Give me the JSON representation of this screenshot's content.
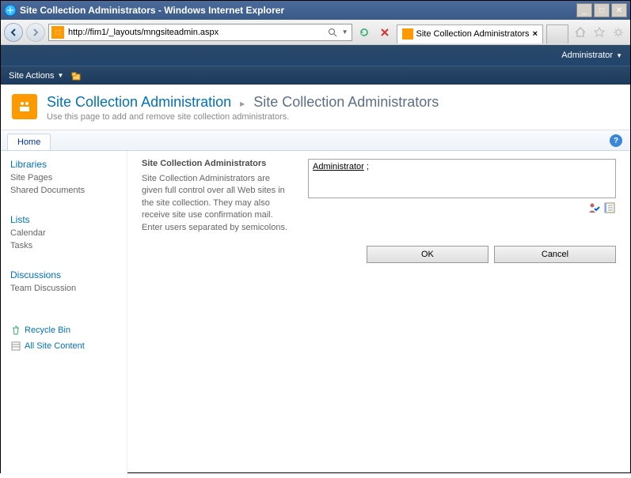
{
  "window": {
    "title": "Site Collection Administrators - Windows Internet Explorer"
  },
  "browser": {
    "url": "http://fim1/_layouts/mngsiteadmin.aspx",
    "tab_title": "Site Collection Administrators"
  },
  "ribbon": {
    "user_label": "Administrator",
    "site_actions_label": "Site Actions"
  },
  "page": {
    "breadcrumb_parent": "Site Collection Administration",
    "breadcrumb_current": "Site Collection Administrators",
    "description": "Use this page to add and remove site collection administrators."
  },
  "topnav": {
    "home_label": "Home"
  },
  "leftnav": {
    "libraries_heading": "Libraries",
    "site_pages": "Site Pages",
    "shared_documents": "Shared Documents",
    "lists_heading": "Lists",
    "calendar": "Calendar",
    "tasks": "Tasks",
    "discussions_heading": "Discussions",
    "team_discussion": "Team Discussion",
    "recycle_bin": "Recycle Bin",
    "all_site_content": "All Site Content"
  },
  "form": {
    "section_title": "Site Collection Administrators",
    "section_desc": "Site Collection Administrators are given full control over all Web sites in the site collection. They may also receive site use confirmation mail. Enter users separated by semicolons.",
    "people_value": "Administrator",
    "ok_label": "OK",
    "cancel_label": "Cancel"
  }
}
